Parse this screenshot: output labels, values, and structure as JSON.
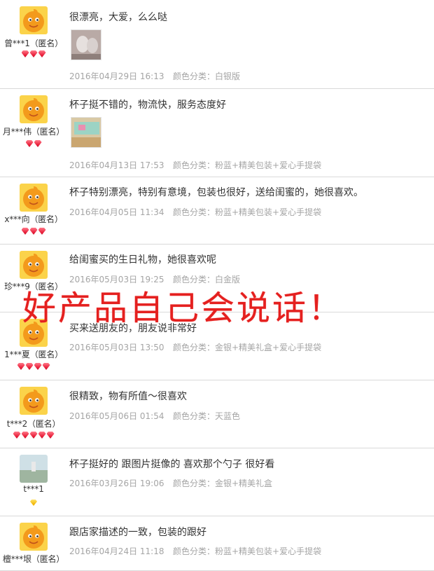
{
  "reviews": [
    {
      "user": "曾***1（匿名）",
      "text": "很漂亮，大爱，么么哒",
      "date": "2016年04月29日 16:13",
      "spec": "颜色分类：白银版",
      "badges": 3,
      "badge_color": "#e81d38",
      "has_thumb": true
    },
    {
      "user": "月***伟（匿名）",
      "text": "杯子挺不错的，物流快，服务态度好",
      "date": "2016年04月13日 17:53",
      "spec": "颜色分类：粉蓝+精美包装+爱心手提袋",
      "badges": 2,
      "badge_color": "#e81d38",
      "has_thumb": true
    },
    {
      "user": "x***向（匿名）",
      "text": "杯子特别漂亮，特别有意境，包装也很好，送给闺蜜的，她很喜欢。",
      "date": "2016年04月05日 11:34",
      "spec": "颜色分类：粉蓝+精美包装+爱心手提袋",
      "badges": 3,
      "badge_color": "#e81d38",
      "has_thumb": false
    },
    {
      "user": "珍***9（匿名）",
      "text": "给闺蜜买的生日礼物，她很喜欢呢",
      "date": "2016年05月03日 19:25",
      "spec": "颜色分类：白金版",
      "badges": 0,
      "badge_color": "#e81d38",
      "has_thumb": false
    },
    {
      "user": "1***夏（匿名）",
      "text": "买来送朋友的，朋友说非常好",
      "date": "2016年05月03日 13:50",
      "spec": "颜色分类：金银+精美礼盒+爱心手提袋",
      "badges": 4,
      "badge_color": "#e81d38",
      "has_thumb": false
    },
    {
      "user": "t***2（匿名）",
      "text": "很精致，物有所值～很喜欢",
      "date": "2016年05月06日 01:54",
      "spec": "颜色分类：天蓝色",
      "badges": 5,
      "badge_color": "#e81d38",
      "has_thumb": false
    },
    {
      "user": "t***1",
      "text": "杯子挺好的 跟图片挺像的 喜欢那个勺子 很好看",
      "date": "2016年03月26日 19:06",
      "spec": "颜色分类：金银+精美礼盒",
      "badges": 1,
      "badge_color": "#f0b400",
      "has_thumb": false
    },
    {
      "user": "檀***垠（匿名）",
      "text": "跟店家描述的一致，包装的跟好",
      "date": "2016年04月24日 11:18",
      "spec": "颜色分类：粉蓝+精美包装+爱心手提袋",
      "badges": 0,
      "badge_color": "#e81d38",
      "has_thumb": false
    }
  ],
  "overlay_text": "好产品自己会说话！",
  "colors": {
    "accent_red": "#e4201f",
    "avatar_orange": "#f7a81b",
    "muted": "#a5a5a5",
    "divider": "#d9d9d9"
  }
}
